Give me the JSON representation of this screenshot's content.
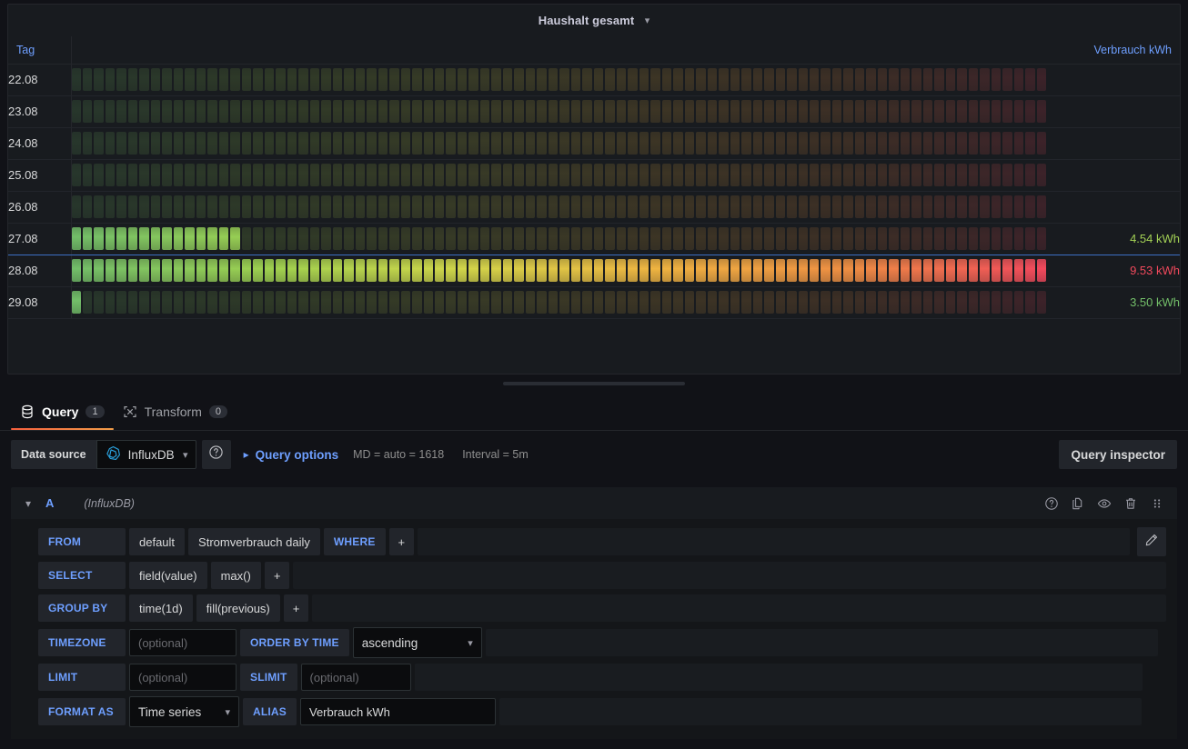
{
  "panel": {
    "title": "Haushalt gesamt",
    "caret_icon": "chevron-down-icon"
  },
  "table": {
    "columns": [
      {
        "label": "Tag",
        "align": "left"
      },
      {
        "label": "",
        "align": "left"
      },
      {
        "label": "Verbrauch kWh",
        "align": "right"
      }
    ],
    "rows": [
      {
        "tag": "22.08",
        "value_text": "",
        "fill_pct": 0,
        "value_color": "#73bf69",
        "selected": false
      },
      {
        "tag": "23.08",
        "value_text": "",
        "fill_pct": 0,
        "value_color": "#73bf69",
        "selected": false
      },
      {
        "tag": "24.08",
        "value_text": "",
        "fill_pct": 0,
        "value_color": "#73bf69",
        "selected": false
      },
      {
        "tag": "25.08",
        "value_text": "",
        "fill_pct": 0,
        "value_color": "#73bf69",
        "selected": false
      },
      {
        "tag": "26.08",
        "value_text": "",
        "fill_pct": 0,
        "value_color": "#73bf69",
        "selected": false
      },
      {
        "tag": "27.08",
        "value_text": "4.54 kWh",
        "fill_pct": 17.3,
        "value_color": "#a3d155",
        "selected": true
      },
      {
        "tag": "28.08",
        "value_text": "9.53 kWh",
        "fill_pct": 99.7,
        "value_color": "#f2495c",
        "selected": false
      },
      {
        "tag": "29.08",
        "value_text": "3.50 kWh",
        "fill_pct": 1.2,
        "value_color": "#73bf69",
        "selected": false
      }
    ],
    "gauge": {
      "cell_count": 86,
      "gradient_stops": [
        "#73bf69",
        "#9fd14f",
        "#d2d64a",
        "#efb441",
        "#ef8f43",
        "#f2495c"
      ],
      "unlit_opacity": 0.17
    }
  },
  "splitter": {
    "grip_icon": "drag-grip-icon"
  },
  "tabs": [
    {
      "label": "Query",
      "badge": "1",
      "icon": "database-icon",
      "active": true
    },
    {
      "label": "Transform",
      "badge": "0",
      "icon": "transform-icon",
      "active": false
    }
  ],
  "datasource_row": {
    "label": "Data source",
    "selected": "InfluxDB",
    "datasource_icon": "influxdb-icon",
    "caret_icon": "chevron-down-icon",
    "help_icon": "question-circle-icon",
    "query_options_label": "Query options",
    "query_options_chevron": "chevron-right-icon",
    "meta_md": "MD = auto = 1618",
    "meta_interval": "Interval = 5m",
    "inspector_label": "Query inspector"
  },
  "query": {
    "collapse_icon": "chevron-down-icon",
    "ref_id": "A",
    "datasource_name": "(InfluxDB)",
    "actions": [
      {
        "name": "help-icon"
      },
      {
        "name": "duplicate-icon"
      },
      {
        "name": "eye-icon"
      },
      {
        "name": "trash-icon"
      },
      {
        "name": "drag-handle-icon"
      }
    ],
    "edit_icon": "pencil-icon",
    "rows": {
      "from": {
        "label": "FROM",
        "policy": "default",
        "measurement": "Stromverbrauch daily",
        "where_label": "WHERE",
        "plus": "+"
      },
      "select": {
        "label": "SELECT",
        "field": "field(value)",
        "agg": "max()",
        "plus": "+"
      },
      "group_by": {
        "label": "GROUP BY",
        "time": "time(1d)",
        "fill": "fill(previous)",
        "plus": "+"
      },
      "timezone": {
        "label": "TIMEZONE",
        "placeholder": "(optional)",
        "value": "",
        "order_label": "ORDER BY TIME",
        "order_value": "ascending",
        "caret_icon": "chevron-down-icon"
      },
      "limit": {
        "label": "LIMIT",
        "placeholder": "(optional)",
        "value": "",
        "slimit_label": "SLIMIT",
        "slimit_placeholder": "(optional)",
        "slimit_value": ""
      },
      "format": {
        "label": "FORMAT AS",
        "value": "Time series",
        "caret_icon": "chevron-down-icon",
        "alias_label": "ALIAS",
        "alias_value": "Verbrauch kWh"
      }
    }
  }
}
